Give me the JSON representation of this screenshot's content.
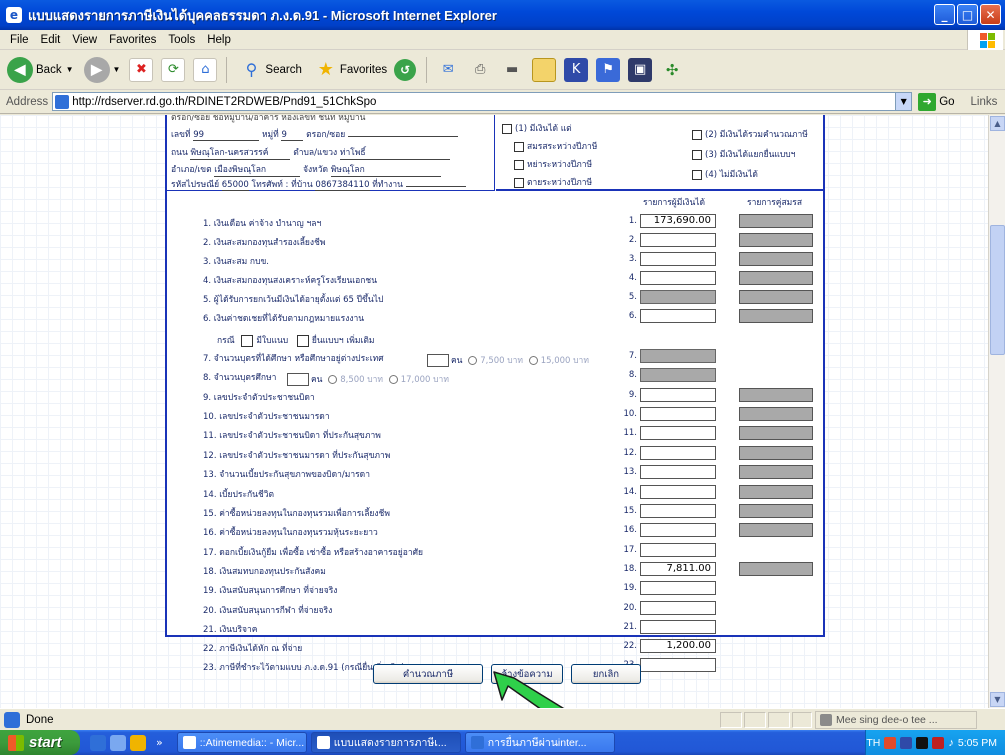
{
  "window": {
    "title": "แบบแสดงรายการภาษีเงินได้บุคคลธรรมดา ภ.ง.ด.91 - Microsoft Internet Explorer",
    "minimize": "_",
    "maximize": "□",
    "close": "✕"
  },
  "menu": [
    "File",
    "Edit",
    "View",
    "Favorites",
    "Tools",
    "Help"
  ],
  "toolbar": {
    "back": "Back",
    "search": "Search",
    "favorites": "Favorites"
  },
  "address": {
    "label": "Address",
    "url": "http://rdserver.rd.go.th/RDINET2RDWEB/Pnd91_51ChkSpo",
    "go": "Go",
    "links": "Links"
  },
  "taxpayer": {
    "cut_line": "ตรอก/ซอย ชื่อหมู่บ้าน/อาคาร ห้องเลขที่ ชั้นที่ หมู่บ้าน",
    "house_no_label": "เลขที่",
    "house_no": "99",
    "moo_label": "หมู่ที่",
    "moo": "9",
    "soi_label": "ตรอก/ซอย",
    "road_label": "ถนน",
    "road": "พิษณุโลก-นครสวรรค์",
    "subdistrict_label": "ตำบล/แขวง",
    "subdistrict": "ท่าโพธิ์",
    "district_label": "อำเภอ/เขต",
    "district": "เมืองพิษณุโลก",
    "province_label": "จังหวัด",
    "province": "พิษณุโลก",
    "postcode_label": "รหัสไปรษณีย์",
    "postcode": "65000",
    "phone_label": "โทรศัพท์ : ที่บ้าน",
    "phone": "0867384110",
    "work_label": "ที่ทำงาน"
  },
  "status": {
    "s1": "(1) มีเงินได้ แต่",
    "s1a": "สมรสระหว่างปีภาษี",
    "s1b": "หย่าระหว่างปีภาษี",
    "s1c": "ตายระหว่างปีภาษี",
    "s2": "(2) มีเงินได้รวมคำนวณภาษี",
    "s3": "(3) มีเงินได้แยกยื่นแบบฯ",
    "s4": "(4) ไม่มีเงินได้"
  },
  "columns": {
    "taxpayer": "รายการผู้มีเงินได้",
    "spouse": "รายการคู่สมรส"
  },
  "rows": [
    {
      "label": "1. เงินเดือน ค่าจ้าง บำนาญ ฯลฯ",
      "num": "1.",
      "value": "173,690.00",
      "gray": false,
      "spouse": true
    },
    {
      "label": "2. เงินสะสมกองทุนสำรองเลี้ยงชีพ",
      "num": "2.",
      "value": "",
      "gray": false,
      "spouse": true
    },
    {
      "label": "3. เงินสะสม กบข.",
      "num": "3.",
      "value": "",
      "gray": false,
      "spouse": true
    },
    {
      "label": "4. เงินสะสมกองทุนสงเคราะห์ครูโรงเรียนเอกชน",
      "num": "4.",
      "value": "",
      "gray": false,
      "spouse": true
    },
    {
      "label": "5. ผู้ได้รับการยกเว้นมีเงินได้อายุตั้งแต่ 65 ปีขึ้นไป",
      "num": "5.",
      "value": "",
      "gray": true,
      "spouse": true
    },
    {
      "label": "6. เงินค่าชดเชยที่ได้รับตามกฎหมายแรงงาน",
      "num": "6.",
      "value": "",
      "gray": false,
      "spouse": true
    },
    {
      "label": "7. จำนวนบุตรที่ได้ศึกษา หรือศึกษาอยู่ต่างประเทศ",
      "num": "7.",
      "value": "",
      "gray": true,
      "spouse": false
    },
    {
      "label": "8. จำนวนบุตรศึกษา",
      "num": "8.",
      "value": "",
      "gray": true,
      "spouse": false
    },
    {
      "label": "9. เลขประจำตัวประชาชนบิดา",
      "num": "9.",
      "value": "",
      "gray": false,
      "spouse": true
    },
    {
      "label": "10. เลขประจำตัวประชาชนมารดา",
      "num": "10.",
      "value": "",
      "gray": false,
      "spouse": true
    },
    {
      "label": "11. เลขประจำตัวประชาชนบิดา ที่ประกันสุขภาพ",
      "num": "11.",
      "value": "",
      "gray": false,
      "spouse": true
    },
    {
      "label": "12. เลขประจำตัวประชาชนมารดา ที่ประกันสุขภาพ",
      "num": "12.",
      "value": "",
      "gray": false,
      "spouse": true
    },
    {
      "label": "13. จำนวนเบี้ยประกันสุขภาพของบิดา/มารดา",
      "num": "13.",
      "value": "",
      "gray": false,
      "spouse": true
    },
    {
      "label": "14. เบี้ยประกันชีวิต",
      "num": "14.",
      "value": "",
      "gray": false,
      "spouse": true
    },
    {
      "label": "15. ค่าซื้อหน่วยลงทุนในกองทุนรวมเพื่อการเลี้ยงชีพ",
      "num": "15.",
      "value": "",
      "gray": false,
      "spouse": true
    },
    {
      "label": "16. ค่าซื้อหน่วยลงทุนในกองทุนรวมหุ้นระยะยาว",
      "num": "16.",
      "value": "",
      "gray": false,
      "spouse": true
    },
    {
      "label": "17. ดอกเบี้ยเงินกู้ยืม เพื่อซื้อ เช่าซื้อ หรือสร้างอาคารอยู่อาศัย",
      "num": "17.",
      "value": "",
      "gray": false,
      "spouse": false
    },
    {
      "label": "18. เงินสมทบกองทุนประกันสังคม",
      "num": "18.",
      "value": "7,811.00",
      "gray": false,
      "spouse": true
    },
    {
      "label": "19. เงินสนับสนุนการศึกษา ที่จ่ายจริง",
      "num": "19.",
      "value": "",
      "gray": false,
      "spouse": false
    },
    {
      "label": "20. เงินสนับสนุนการกีฬา ที่จ่ายจริง",
      "num": "20.",
      "value": "",
      "gray": false,
      "spouse": false
    },
    {
      "label": "21. เงินบริจาค",
      "num": "21.",
      "value": "",
      "gray": false,
      "spouse": false
    },
    {
      "label": "22. ภาษีเงินได้หัก ณ ที่จ่าย",
      "num": "22.",
      "value": "1,200.00",
      "gray": false,
      "spouse": false
    },
    {
      "label": "23. ภาษีที่ชำระไว้ตามแบบ ภ.ง.ด.91 (กรณียื่นเพิ่มเติม)",
      "num": "23.",
      "value": "",
      "gray": false,
      "spouse": false
    }
  ],
  "extras": {
    "case_label": "กรณี",
    "opt1": "มีใบแนบ",
    "opt2": "ยื่นแบบฯ เพิ่มเติม",
    "unit": "คน",
    "r7a": "7,500 บาท",
    "r7b": "15,000 บาท",
    "r8a": "8,500 บาท",
    "r8b": "17,000 บาท"
  },
  "buttons": {
    "calc": "คำนวณภาษี",
    "clear": "ล้างข้อความ",
    "cancel": "ยกเลิก"
  },
  "statusbar": {
    "status": "Done",
    "user": "Mee sing dee-o tee ..."
  },
  "taskbar": {
    "start": "start",
    "tasks": [
      "::Atimemedia:: - Micr...",
      "แบบแสดงรายการภาษีเ...",
      "การยื่นภาษีผ่านinter..."
    ],
    "lang": "TH",
    "clock": "5:05 PM"
  },
  "colors": {
    "form_border": "#1a33b8",
    "pointer_arrow": "#2fd04a"
  }
}
